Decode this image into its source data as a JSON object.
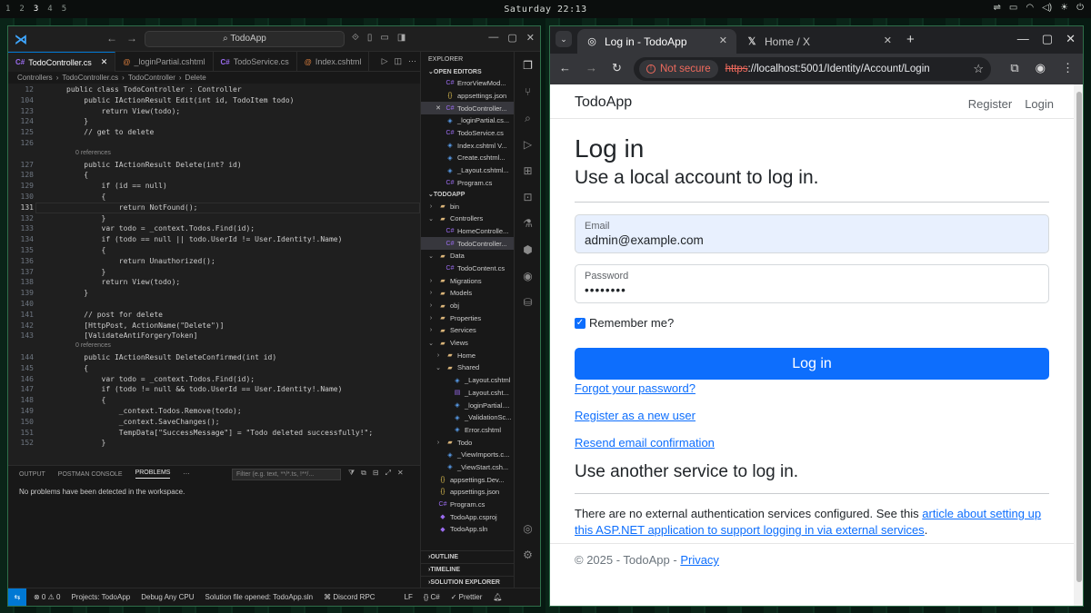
{
  "topbar": {
    "workspaces": [
      "1",
      "2",
      "3",
      "4",
      "5"
    ],
    "clock": "Saturday 22:13",
    "tray_icons": [
      "bluetooth-icon",
      "battery-icon",
      "wifi-icon",
      "volume-icon",
      "brightness-icon",
      "power-icon"
    ]
  },
  "vscode": {
    "search": "TodoApp",
    "tabs": [
      {
        "label": "TodoController.cs",
        "kind": "cs",
        "active": true
      },
      {
        "label": "_loginPartial.cshtml",
        "kind": "razor"
      },
      {
        "label": "TodoService.cs",
        "kind": "cs"
      },
      {
        "label": "Index.cshtml",
        "kind": "razor"
      }
    ],
    "breadcrumb": [
      "Controllers",
      "TodoController.cs",
      "TodoController",
      "Delete"
    ],
    "code_lines": [
      {
        "n": "12",
        "t": "public class TodoController : Controller"
      },
      {
        "n": "104",
        "t": "    public IActionResult Edit(int id, TodoItem todo)"
      },
      {
        "n": "123",
        "t": "        return View(todo);"
      },
      {
        "n": "124",
        "t": "    }"
      },
      {
        "n": "125",
        "t": "    // get to delete"
      },
      {
        "n": "126",
        "t": ""
      },
      {
        "n": "",
        "hint": "0 references"
      },
      {
        "n": "127",
        "t": "    public IActionResult Delete(int? id)"
      },
      {
        "n": "128",
        "t": "    {"
      },
      {
        "n": "129",
        "t": "        if (id == null)"
      },
      {
        "n": "130",
        "t": "        {"
      },
      {
        "n": "131",
        "t": "            return NotFound();"
      },
      {
        "n": "132",
        "t": "        }"
      },
      {
        "n": "133",
        "t": "        var todo = _context.Todos.Find(id);"
      },
      {
        "n": "134",
        "t": "        if (todo == null || todo.UserId != User.Identity!.Name)"
      },
      {
        "n": "135",
        "t": "        {"
      },
      {
        "n": "136",
        "t": "            return Unauthorized();"
      },
      {
        "n": "137",
        "t": "        }"
      },
      {
        "n": "138",
        "t": "        return View(todo);"
      },
      {
        "n": "139",
        "t": "    }"
      },
      {
        "n": "140",
        "t": ""
      },
      {
        "n": "141",
        "t": "    // post for delete"
      },
      {
        "n": "142",
        "t": "    [HttpPost, ActionName(\"Delete\")]"
      },
      {
        "n": "143",
        "t": "    [ValidateAntiForgeryToken]"
      },
      {
        "n": "",
        "hint": "0 references"
      },
      {
        "n": "144",
        "t": "    public IActionResult DeleteConfirmed(int id)"
      },
      {
        "n": "145",
        "t": "    {"
      },
      {
        "n": "146",
        "t": "        var todo = _context.Todos.Find(id);"
      },
      {
        "n": "147",
        "t": "        if (todo != null && todo.UserId == User.Identity!.Name)"
      },
      {
        "n": "148",
        "t": "        {"
      },
      {
        "n": "149",
        "t": "            _context.Todos.Remove(todo);"
      },
      {
        "n": "150",
        "t": "            _context.SaveChanges();"
      },
      {
        "n": "151",
        "t": "            TempData[\"SuccessMessage\"] = \"Todo deleted successfully!\";"
      },
      {
        "n": "152",
        "t": "        }"
      }
    ],
    "panel": {
      "tabs": [
        "OUTPUT",
        "POSTMAN CONSOLE",
        "PROBLEMS"
      ],
      "active_tab": "PROBLEMS",
      "filter_placeholder": "Filter (e.g. text, **/*.ts, !**/...",
      "message": "No problems have been detected in the workspace."
    },
    "explorer": {
      "title": "EXPLORER",
      "open_editors_header": "OPEN EDITORS",
      "open_editors": [
        {
          "label": "ErrorViewMod...",
          "kind": "cs",
          "indent": 1
        },
        {
          "label": "appsettings.json",
          "kind": "json",
          "indent": 1
        },
        {
          "label": "TodoController...",
          "kind": "cs",
          "indent": 1,
          "selected": true,
          "close": true
        },
        {
          "label": "_loginPartial.cs...",
          "kind": "razor",
          "indent": 1
        },
        {
          "label": "TodoService.cs",
          "kind": "cs",
          "indent": 1
        },
        {
          "label": "Index.cshtml V...",
          "kind": "razor",
          "indent": 1
        },
        {
          "label": "Create.cshtml...",
          "kind": "razor",
          "indent": 1
        },
        {
          "label": "_Layout.cshtml...",
          "kind": "razor",
          "indent": 1
        },
        {
          "label": "Program.cs",
          "kind": "cs",
          "indent": 1
        }
      ],
      "project_header": "TODOAPP",
      "tree": [
        {
          "label": "bin",
          "kind": "folder",
          "indent": 0,
          "chev": "›"
        },
        {
          "label": "Controllers",
          "kind": "folder",
          "indent": 0,
          "chev": "⌄"
        },
        {
          "label": "HomeControlle...",
          "kind": "cs",
          "indent": 1
        },
        {
          "label": "TodoController...",
          "kind": "cs",
          "indent": 1,
          "selected": true
        },
        {
          "label": "Data",
          "kind": "folder",
          "indent": 0,
          "chev": "⌄"
        },
        {
          "label": "TodoContent.cs",
          "kind": "cs",
          "indent": 1
        },
        {
          "label": "Migrations",
          "kind": "folder",
          "indent": 0,
          "chev": "›"
        },
        {
          "label": "Models",
          "kind": "folder",
          "indent": 0,
          "chev": "›"
        },
        {
          "label": "obj",
          "kind": "folder",
          "indent": 0,
          "chev": "›"
        },
        {
          "label": "Properties",
          "kind": "folder",
          "indent": 0,
          "chev": "›"
        },
        {
          "label": "Services",
          "kind": "folder",
          "indent": 0,
          "chev": "›"
        },
        {
          "label": "Views",
          "kind": "folder",
          "indent": 0,
          "chev": "⌄"
        },
        {
          "label": "Home",
          "kind": "folder",
          "indent": 1,
          "chev": "›"
        },
        {
          "label": "Shared",
          "kind": "folder",
          "indent": 1,
          "chev": "⌄"
        },
        {
          "label": "_Layout.cshtml",
          "kind": "razor",
          "indent": 2
        },
        {
          "label": "_Layout.csht...",
          "kind": "css",
          "indent": 2
        },
        {
          "label": "_loginPartial....",
          "kind": "razor",
          "indent": 2
        },
        {
          "label": "_ValidationSc...",
          "kind": "razor",
          "indent": 2
        },
        {
          "label": "Error.cshtml",
          "kind": "razor",
          "indent": 2
        },
        {
          "label": "Todo",
          "kind": "folder",
          "indent": 1,
          "chev": "›"
        },
        {
          "label": "_ViewImports.c...",
          "kind": "razor",
          "indent": 1
        },
        {
          "label": "_ViewStart.csh...",
          "kind": "razor",
          "indent": 1
        },
        {
          "label": "appsettings.Dev...",
          "kind": "json",
          "indent": 0
        },
        {
          "label": "appsettings.json",
          "kind": "json",
          "indent": 0
        },
        {
          "label": "Program.cs",
          "kind": "cs",
          "indent": 0
        },
        {
          "label": "TodoApp.csproj",
          "kind": "proj",
          "indent": 0
        },
        {
          "label": "TodoApp.sln",
          "kind": "proj",
          "indent": 0
        }
      ],
      "bottom_sections": [
        "OUTLINE",
        "TIMELINE",
        "SOLUTION EXPLORER"
      ]
    },
    "statusbar": {
      "problems": "⊗ 0  ⚠ 0",
      "project": "Projects: TodoApp",
      "config": "Debug Any CPU",
      "solution": "Solution file opened: TodoApp.sln",
      "discord": "⌘ Discord RPC",
      "eol": "LF",
      "lang": "{} C#",
      "prettier": "✓ Prettier"
    }
  },
  "browser": {
    "tabs": [
      {
        "title": "Log in - TodoApp",
        "active": true
      },
      {
        "title": "Home / X",
        "active": false
      }
    ],
    "not_secure": "Not secure",
    "url_proto": "https",
    "url_rest": "://localhost:5001/Identity/Account/Login",
    "page": {
      "brand": "TodoApp",
      "nav_register": "Register",
      "nav_login": "Login",
      "h1": "Log in",
      "subtitle": "Use a local account to log in.",
      "email_label": "Email",
      "email_value": "admin@example.com",
      "password_label": "Password",
      "password_value": "••••••••",
      "remember": "Remember me?",
      "login_button": "Log in",
      "forgot": "Forgot your password?",
      "register_link": "Register as a new user",
      "resend": "Resend email confirmation",
      "other_heading": "Use another service to log in.",
      "ext_text_before": "There are no external authentication services configured. See this ",
      "ext_link": "article about setting up this ASP.NET application to support logging in via external services",
      "ext_text_after": ".",
      "footer_text": "© 2025 - TodoApp - ",
      "footer_link": "Privacy"
    }
  }
}
